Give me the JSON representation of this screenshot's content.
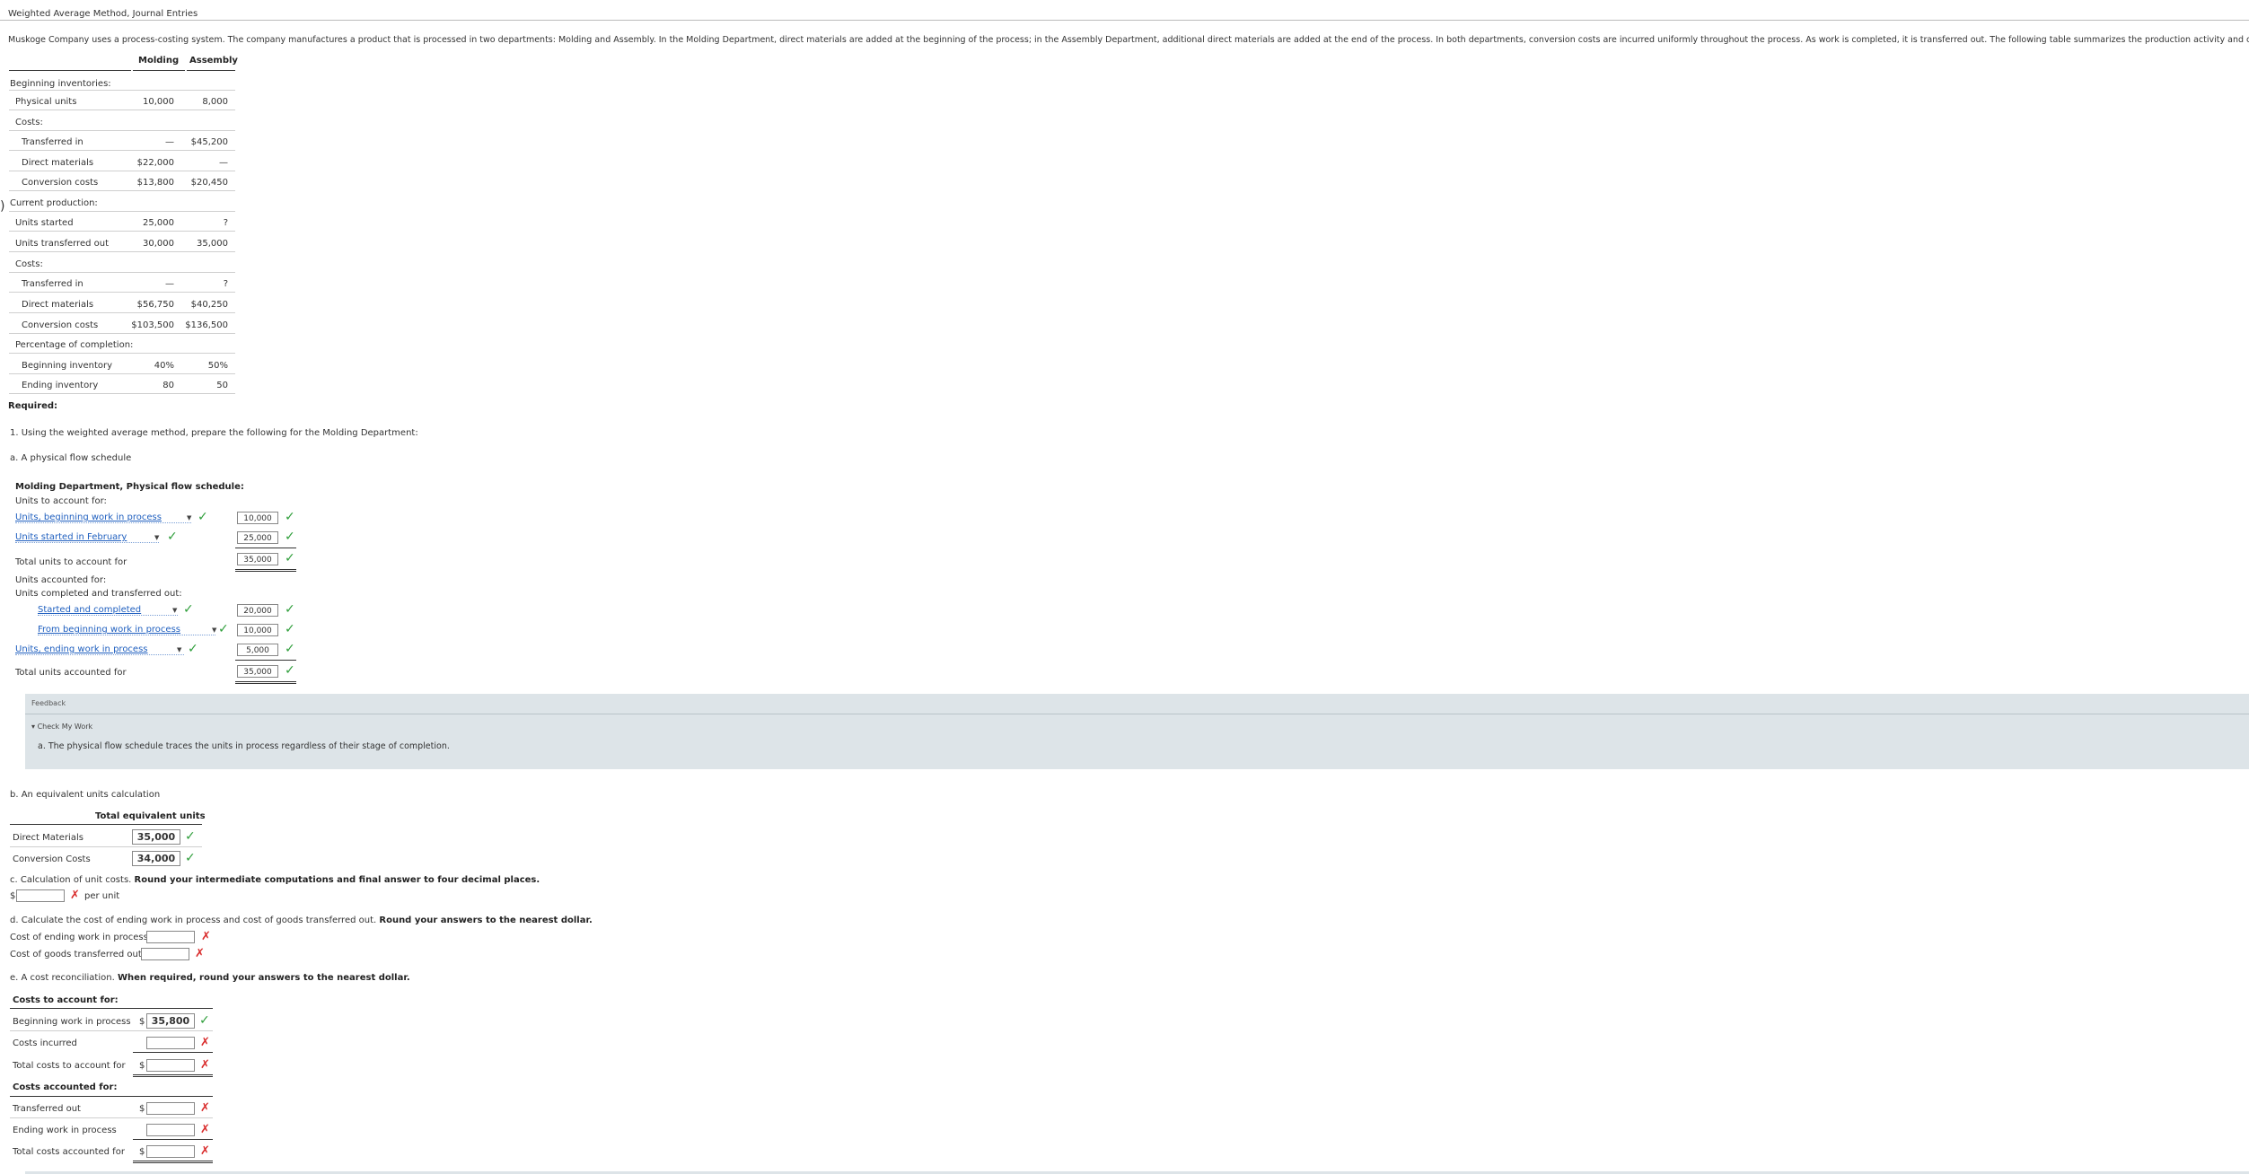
{
  "page_title": "Weighted Average Method, Journal Entries",
  "intro": "Muskoge Company uses a process-costing system. The company manufactures a product that is processed in two departments: Molding and Assembly. In the Molding Department, direct materials are added at the beginning of the process; in the Assembly Department, additional direct materials are added at the end of the process. In both departments, conversion costs are incurred uniformly throughout the process. As work is completed, it is transferred out. The following table summarizes the production activity and costs for February:",
  "table": {
    "headers": [
      "Molding",
      "Assembly"
    ],
    "rows": [
      {
        "label": "Beginning inventories:",
        "molding": "",
        "assembly": ""
      },
      {
        "label": "Physical units",
        "molding": "10,000",
        "assembly": "8,000"
      },
      {
        "label": "Costs:",
        "molding": "",
        "assembly": ""
      },
      {
        "label": "Transferred in",
        "molding": "—",
        "assembly": "$45,200"
      },
      {
        "label": "Direct materials",
        "molding": "$22,000",
        "assembly": "—"
      },
      {
        "label": "Conversion costs",
        "molding": "$13,800",
        "assembly": "$20,450"
      },
      {
        "label": "Current production:",
        "molding": "",
        "assembly": ""
      },
      {
        "label": "Units started",
        "molding": "25,000",
        "assembly": "?"
      },
      {
        "label": "Units transferred out",
        "molding": "30,000",
        "assembly": "35,000"
      },
      {
        "label": "Costs:",
        "molding": "",
        "assembly": ""
      },
      {
        "label": "Transferred in",
        "molding": "—",
        "assembly": "?"
      },
      {
        "label": "Direct materials",
        "molding": "$56,750",
        "assembly": "$40,250"
      },
      {
        "label": "Conversion costs",
        "molding": "$103,500",
        "assembly": "$136,500"
      },
      {
        "label": "Percentage of completion:",
        "molding": "",
        "assembly": ""
      },
      {
        "label": "Beginning inventory",
        "molding": "40%",
        "assembly": "50%"
      },
      {
        "label": "Ending inventory",
        "molding": "80",
        "assembly": "50"
      }
    ]
  },
  "required_label": "Required:",
  "q1_text": "1. Using the weighted average method, prepare the following for the Molding Department:",
  "qa_label": "a. A physical flow schedule",
  "schedule": {
    "title": "Molding Department, Physical flow schedule:",
    "units_to_account_for": "Units to account for:",
    "sel_beginning": "Units, beginning work in process",
    "val_beginning": "10,000",
    "sel_started": "Units started in February",
    "val_started": "25,000",
    "total_to_account_label": "Total units to account for",
    "total_to_account_val": "35,000",
    "units_accounted_for": "Units accounted for:",
    "units_completed": "Units completed and transferred out:",
    "sel_started_completed": "Started and completed",
    "val_started_completed": "20,000",
    "sel_from_beginning": "From beginning work in process",
    "val_from_beginning": "10,000",
    "sel_ending": "Units, ending work in process",
    "val_ending": "5,000",
    "total_accounted_label": "Total units accounted for",
    "total_accounted_val": "35,000"
  },
  "feedback": {
    "title": "Feedback",
    "check": "Check My Work",
    "text": "a. The physical flow schedule traces the units in process regardless of their stage of completion."
  },
  "qb": {
    "label": "b. An equivalent units calculation",
    "header": "Total equivalent units",
    "dm_label": "Direct Materials",
    "dm_val": "35,000",
    "cc_label": "Conversion Costs",
    "cc_val": "34,000"
  },
  "qc": {
    "label": "c. Calculation of unit costs.",
    "instr": "Round your intermediate computations and final answer to four decimal places.",
    "dollar": "$",
    "per_unit": "per unit",
    "value": ""
  },
  "qd": {
    "label": "d. Calculate the cost of ending work in process and cost of goods transferred out.",
    "instr": "Round your answers to the nearest dollar.",
    "ending_label": "Cost of ending work in process: $",
    "transferred_label": "Cost of goods transferred out: $",
    "ending_val": "",
    "transferred_val": ""
  },
  "qe": {
    "label": "e. A cost reconciliation.",
    "instr": "When required, round your answers to the nearest dollar.",
    "costs_to_account": "Costs to account for:",
    "beginning_wip": "Beginning work in process",
    "beginning_wip_val": "35,800",
    "costs_incurred": "Costs incurred",
    "total_costs_to_account": "Total costs to account for",
    "costs_accounted": "Costs accounted for:",
    "transferred_out": "Transferred out",
    "ending_wip": "Ending work in process",
    "total_costs_accounted": "Total costs accounted for",
    "dollar": "$"
  }
}
